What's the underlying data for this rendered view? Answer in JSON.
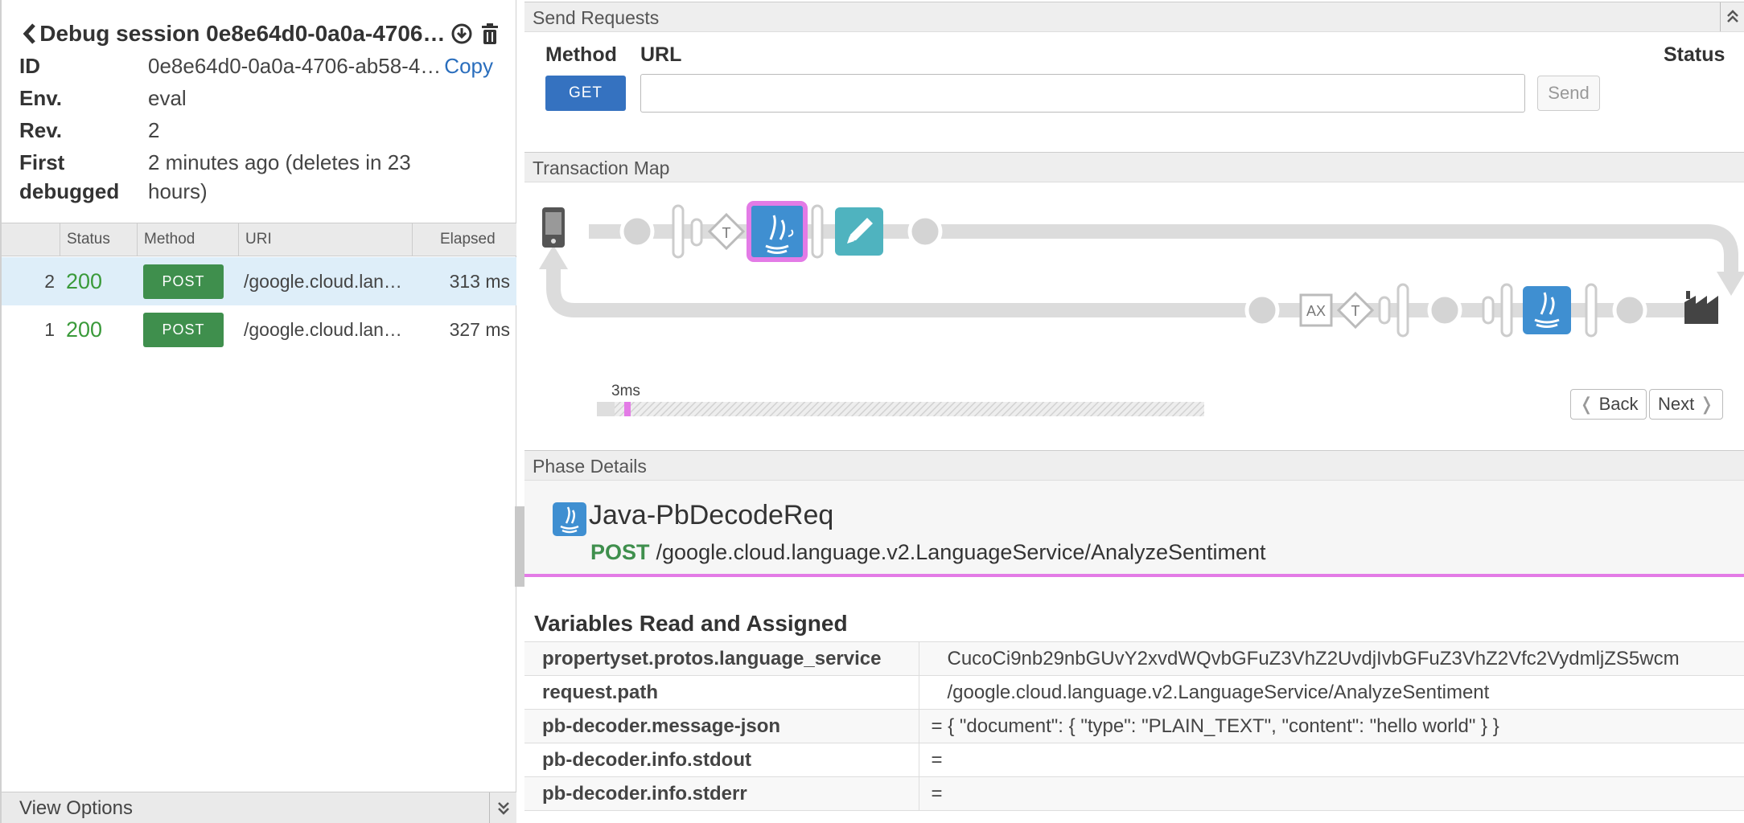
{
  "session": {
    "title": "Debug session 0e8e64d0-0a0a-4706-a…",
    "id_label": "ID",
    "id_value": "0e8e64d0-0a0a-4706-ab58-4…",
    "copy_label": "Copy",
    "env_label": "Env.",
    "env_value": "eval",
    "rev_label": "Rev.",
    "rev_value": "2",
    "first_label_1": "First",
    "first_label_2": "debugged",
    "first_value_1": "2 minutes ago (deletes in 23",
    "first_value_2": "hours)"
  },
  "transactions": {
    "columns": [
      "Status",
      "Method",
      "URI",
      "Elapsed"
    ],
    "rows": [
      {
        "num": "2",
        "status": "200",
        "method": "POST",
        "uri": "/google.cloud.lan…",
        "elapsed": "313 ms",
        "selected": true
      },
      {
        "num": "1",
        "status": "200",
        "method": "POST",
        "uri": "/google.cloud.lan…",
        "elapsed": "327 ms",
        "selected": false
      }
    ]
  },
  "view_options": "View Options",
  "send_requests": {
    "header": "Send Requests",
    "method_label": "Method",
    "url_label": "URL",
    "status_label": "Status",
    "method_value": "GET",
    "url_value": "",
    "send_label": "Send"
  },
  "transaction_map": {
    "header": "Transaction Map",
    "node_labels": {
      "t": "T",
      "ax": "AX"
    },
    "timeline_label": "3ms",
    "back_label": "Back",
    "next_label": "Next"
  },
  "phase_details": {
    "header": "Phase Details",
    "title": "Java-PbDecodeReq",
    "method": "POST",
    "path": "/google.cloud.language.v2.LanguageService/AnalyzeSentiment"
  },
  "variables": {
    "title": "Variables Read and Assigned",
    "rows": [
      {
        "name": "propertyset.protos.language_service",
        "value": "   CucoCi9nb29nbGUvY2xvdWQvbGFuZ3VhZ2UvdjIvbGFuZ3VhZ2Vfc2VydmljZS5wcm"
      },
      {
        "name": "request.path",
        "value": "   /google.cloud.language.v2.LanguageService/AnalyzeSentiment"
      },
      {
        "name": "pb-decoder.message-json",
        "value": "= { \"document\": { \"type\": \"PLAIN_TEXT\", \"content\": \"hello world\" } }"
      },
      {
        "name": "pb-decoder.info.stdout",
        "value": "="
      },
      {
        "name": "pb-decoder.info.stderr",
        "value": "="
      }
    ]
  },
  "colors": {
    "accent_blue": "#3572c0",
    "success_green": "#3f8f4d",
    "highlight_pink": "#e37be6",
    "policy_teal": "#4fb3bf",
    "java_blue": "#3f8fd1"
  }
}
